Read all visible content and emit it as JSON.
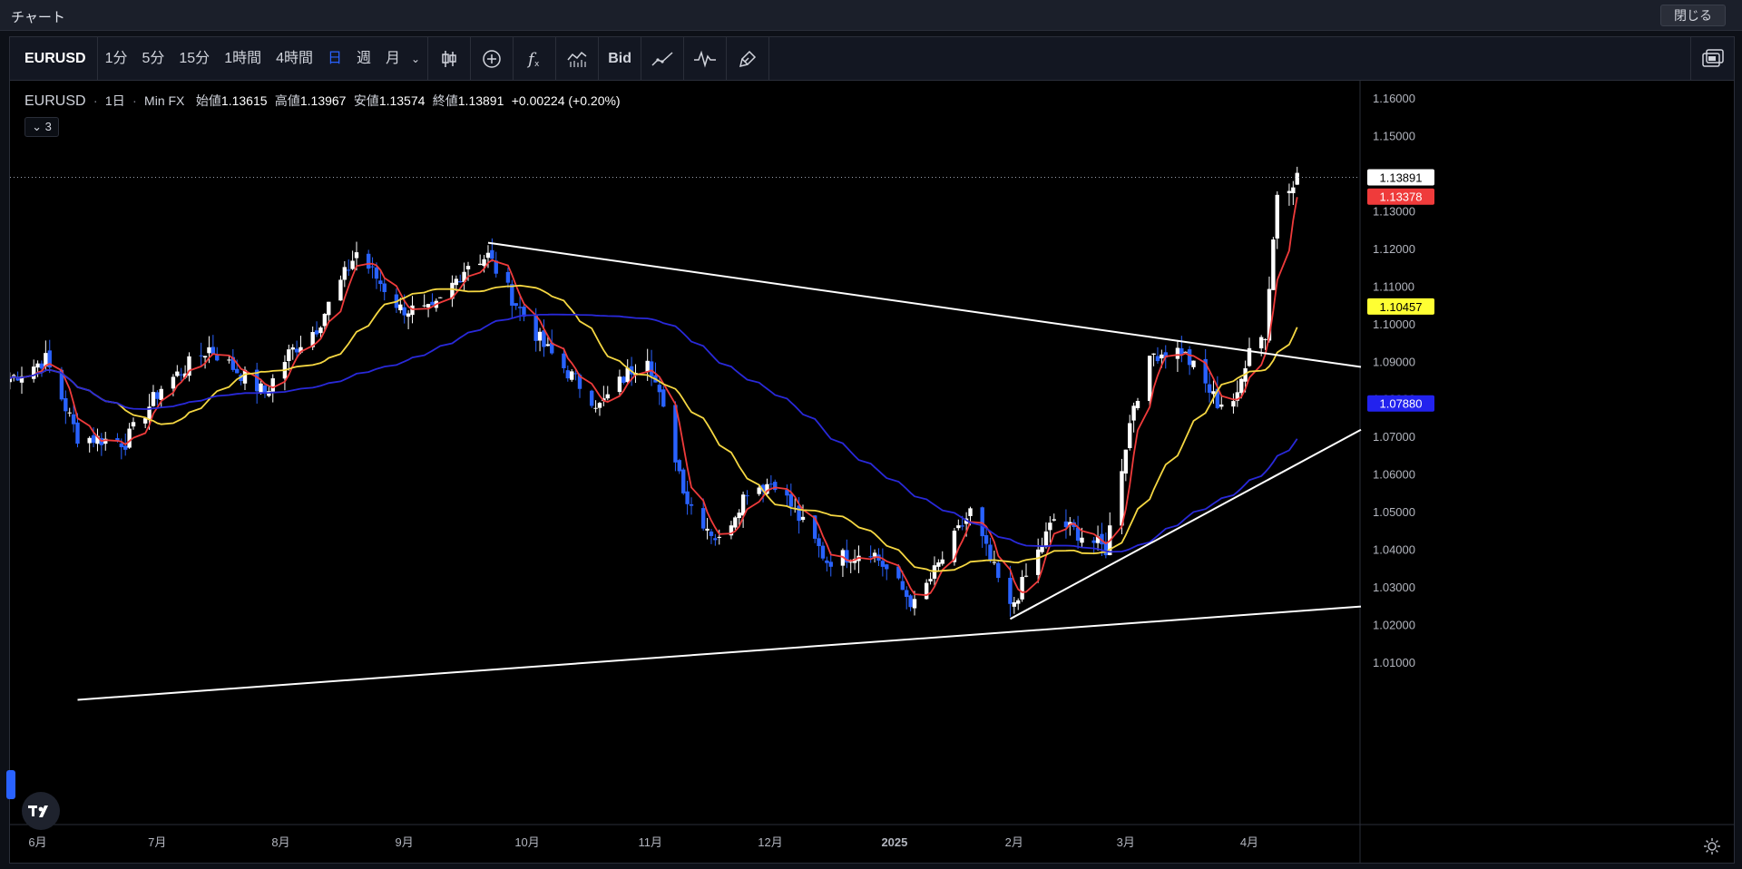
{
  "window": {
    "title": "チャート",
    "close_label": "閉じる"
  },
  "toolbar": {
    "symbol": "EURUSD",
    "intervals": [
      "1分",
      "5分",
      "15分",
      "1時間",
      "4時間",
      "日",
      "週",
      "月"
    ],
    "active_interval": "日",
    "bid_label": "Bid",
    "icons": [
      "candles-icon",
      "add-indicator-icon",
      "formula-icon",
      "compare-icon",
      "line-tool-icon",
      "pulse-icon",
      "brush-icon",
      "layout-icon"
    ]
  },
  "legend": {
    "symbol": "EURUSD",
    "interval": "1日",
    "source": "Min FX",
    "open_label": "始値",
    "open": "1.13615",
    "high_label": "高値",
    "high": "1.13967",
    "low_label": "安値",
    "low": "1.13574",
    "close_label": "終値",
    "close": "1.13891",
    "change": "+0.00224 (+0.20%)",
    "indicator_count": "3"
  },
  "colors": {
    "up_candle": "#ffffff",
    "down_candle": "#2962ff",
    "ma_fast": "#ef3b3b",
    "ma_mid": "#f5d742",
    "ma_slow": "#2929d9",
    "trendline": "#ffffff"
  },
  "chart_data": {
    "type": "candlestick",
    "title": "",
    "xlabel": "",
    "ylabel": "",
    "ylim": [
      1.0,
      1.165
    ],
    "y_ticks": [
      "1.16000",
      "1.15000",
      "1.14000",
      "1.13000",
      "1.12000",
      "1.11000",
      "1.10000",
      "1.09000",
      "1.08000",
      "1.07000",
      "1.06000",
      "1.05000",
      "1.04000",
      "1.03000",
      "1.02000",
      "1.01000"
    ],
    "x_ticks": [
      {
        "label": "6月",
        "date": "2024-06-01"
      },
      {
        "label": "7月",
        "date": "2024-07-01"
      },
      {
        "label": "8月",
        "date": "2024-08-01"
      },
      {
        "label": "9月",
        "date": "2024-09-01"
      },
      {
        "label": "10月",
        "date": "2024-10-01"
      },
      {
        "label": "11月",
        "date": "2024-11-01"
      },
      {
        "label": "12月",
        "date": "2024-12-01"
      },
      {
        "label": "2025",
        "date": "2025-01-01"
      },
      {
        "label": "2月",
        "date": "2025-02-01"
      },
      {
        "label": "3月",
        "date": "2025-03-01"
      },
      {
        "label": "4月",
        "date": "2025-04-01"
      }
    ],
    "price_anchors": [
      [
        "2024-05-28",
        1.0855
      ],
      [
        "2024-06-06",
        1.0905
      ],
      [
        "2024-06-14",
        1.07
      ],
      [
        "2024-06-26",
        1.0685
      ],
      [
        "2024-07-05",
        1.083
      ],
      [
        "2024-07-17",
        1.0935
      ],
      [
        "2024-07-31",
        1.0815
      ],
      [
        "2024-08-06",
        1.092
      ],
      [
        "2024-08-13",
        1.099
      ],
      [
        "2024-08-23",
        1.119
      ],
      [
        "2024-09-03",
        1.104
      ],
      [
        "2024-09-11",
        1.103
      ],
      [
        "2024-09-20",
        1.116
      ],
      [
        "2024-09-25",
        1.118
      ],
      [
        "2024-10-01",
        1.107
      ],
      [
        "2024-10-09",
        1.094
      ],
      [
        "2024-10-23",
        1.078
      ],
      [
        "2024-10-31",
        1.088
      ],
      [
        "2024-11-04",
        1.092
      ],
      [
        "2024-11-14",
        1.053
      ],
      [
        "2024-11-22",
        1.042
      ],
      [
        "2024-11-29",
        1.056
      ],
      [
        "2024-12-06",
        1.058
      ],
      [
        "2024-12-19",
        1.037
      ],
      [
        "2024-12-30",
        1.04
      ],
      [
        "2025-01-10",
        1.025
      ],
      [
        "2025-01-24",
        1.05
      ],
      [
        "2025-02-03",
        1.024
      ],
      [
        "2025-02-14",
        1.048
      ],
      [
        "2025-02-27",
        1.04
      ],
      [
        "2025-03-06",
        1.079
      ],
      [
        "2025-03-11",
        1.092
      ],
      [
        "2025-03-18",
        1.093
      ],
      [
        "2025-03-27",
        1.079
      ],
      [
        "2025-04-01",
        1.08
      ],
      [
        "2025-04-04",
        1.095
      ],
      [
        "2025-04-08",
        1.097
      ],
      [
        "2025-04-11",
        1.135
      ],
      [
        "2025-04-16",
        1.139
      ]
    ],
    "series": [
      {
        "name": "",
        "values_note": "",
        "last": 1.13378
      },
      {
        "name": "",
        "last": 1.10457
      },
      {
        "name": "",
        "last": 1.0788
      }
    ],
    "price_labels": [
      {
        "value": "1.13891",
        "kind": "last_price"
      },
      {
        "value": "1.13378",
        "kind": "ma_fast"
      },
      {
        "value": "1.10457",
        "kind": "ma_mid"
      },
      {
        "value": "1.07880",
        "kind": "ma_slow"
      }
    ],
    "trendlines": [
      {
        "from": [
          "2024-09-25",
          1.1215
        ],
        "to": [
          "2025-05-02",
          1.0885
        ]
      },
      {
        "from": [
          "2024-06-14",
          1.0
        ],
        "to": [
          "2025-05-02",
          1.0248
        ]
      },
      {
        "from": [
          "2025-02-03",
          1.0215
        ],
        "to": [
          "2025-05-02",
          1.0718
        ]
      }
    ]
  }
}
